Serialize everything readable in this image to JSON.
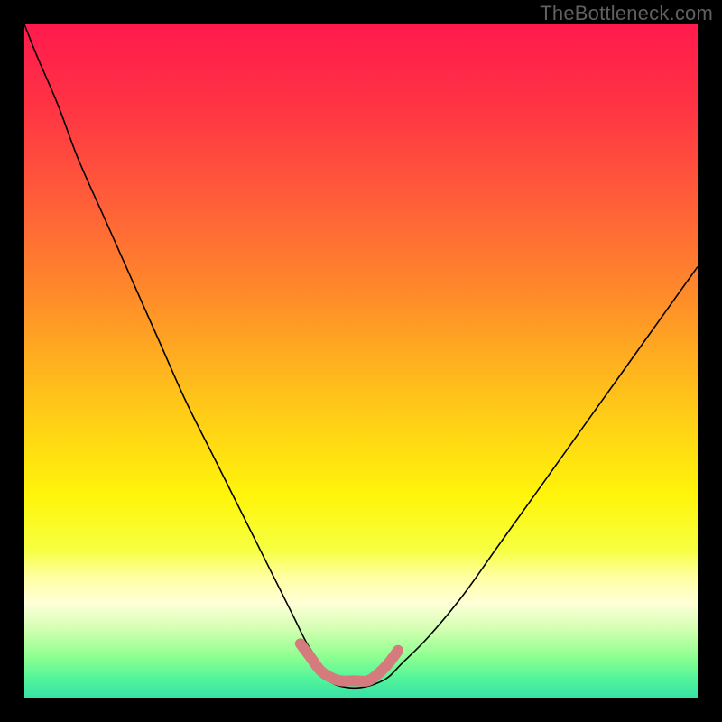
{
  "watermark": "TheBottleneck.com",
  "chart_data": {
    "type": "line",
    "title": "",
    "xlabel": "",
    "ylabel": "",
    "xlim": [
      0,
      100
    ],
    "ylim": [
      0,
      100
    ],
    "grid": false,
    "legend": false,
    "background_gradient": {
      "stops": [
        {
          "offset": 0.0,
          "color": "#ff1a4d"
        },
        {
          "offset": 0.12,
          "color": "#ff3344"
        },
        {
          "offset": 0.25,
          "color": "#ff5a3a"
        },
        {
          "offset": 0.4,
          "color": "#ff8a2a"
        },
        {
          "offset": 0.55,
          "color": "#ffc21a"
        },
        {
          "offset": 0.7,
          "color": "#fff50a"
        },
        {
          "offset": 0.78,
          "color": "#f6ff40"
        },
        {
          "offset": 0.82,
          "color": "#ffffa0"
        },
        {
          "offset": 0.86,
          "color": "#ffffd8"
        },
        {
          "offset": 0.9,
          "color": "#d0ffb0"
        },
        {
          "offset": 0.94,
          "color": "#8cff90"
        },
        {
          "offset": 0.97,
          "color": "#55f59a"
        },
        {
          "offset": 1.0,
          "color": "#36e2a5"
        }
      ]
    },
    "series": [
      {
        "name": "curve",
        "stroke": "#000000",
        "stroke_width": 1.6,
        "x": [
          0,
          2,
          5,
          8,
          12,
          16,
          20,
          24,
          28,
          32,
          36,
          38,
          40,
          42,
          44,
          45,
          46,
          48,
          50,
          52,
          54,
          56,
          60,
          65,
          70,
          75,
          80,
          85,
          90,
          95,
          100
        ],
        "y": [
          100,
          95,
          88,
          80,
          71,
          62,
          53,
          44,
          36,
          28,
          20,
          16,
          12,
          8,
          5,
          3,
          2,
          1.5,
          1.5,
          2,
          3,
          5,
          9,
          15,
          22,
          29,
          36,
          43,
          50,
          57,
          64
        ]
      },
      {
        "name": "highlight-segment",
        "stroke": "#d57b7d",
        "stroke_width": 12,
        "linecap": "round",
        "x": [
          41,
          42.5,
          44,
          45.5,
          47,
          49,
          51,
          52.5,
          54,
          55.5
        ],
        "y": [
          8,
          6,
          4,
          3,
          2.5,
          2.5,
          2.5,
          3.5,
          5,
          7
        ]
      }
    ]
  }
}
